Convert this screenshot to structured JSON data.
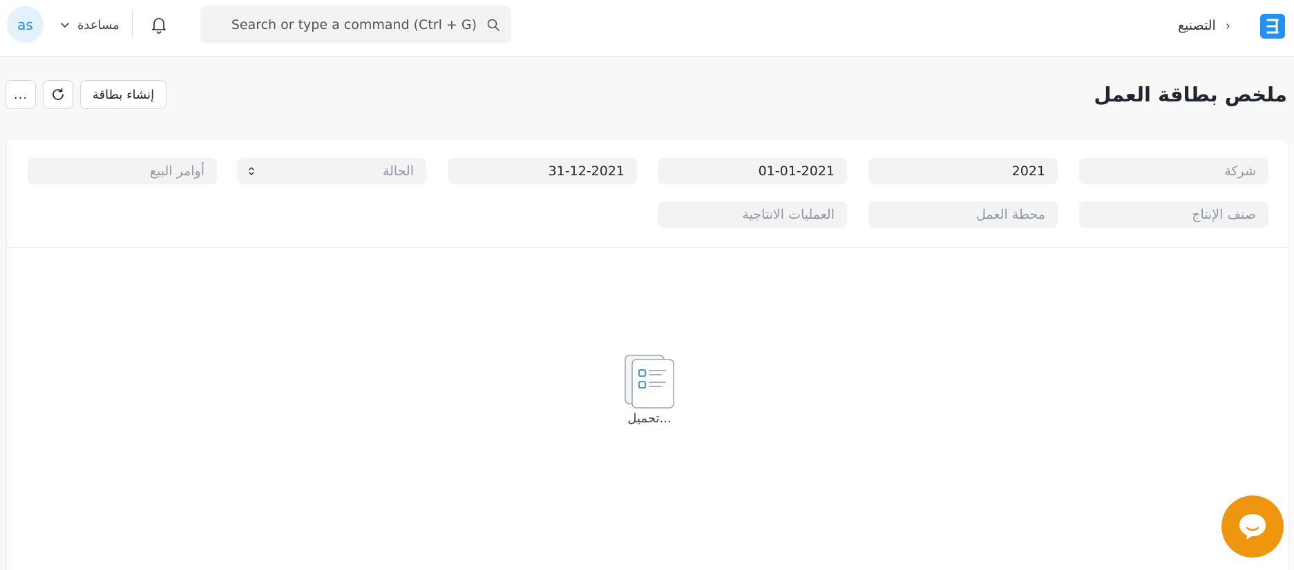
{
  "navbar": {
    "avatar_initials": "as",
    "help_label": "مساعدة",
    "search_placeholder": "Search or type a command (Ctrl + G)",
    "breadcrumb": [
      "التصنيع"
    ],
    "logo_letter": "E",
    "brand_color": "#2490ef"
  },
  "page": {
    "title": "ملخص بطاقة العمل",
    "create_button": "إنشاء بطاقة",
    "menu_button": "...",
    "refresh_icon": "refresh-icon"
  },
  "filters": {
    "company": {
      "placeholder": "شركة",
      "value": ""
    },
    "fiscal_year": {
      "placeholder": "",
      "value": "2021"
    },
    "from_date": {
      "placeholder": "",
      "value": "01-01-2021"
    },
    "to_date": {
      "placeholder": "",
      "value": "31-12-2021"
    },
    "status": {
      "placeholder": "الحالة",
      "value": ""
    },
    "sales_orders": {
      "placeholder": "أوامر البيع",
      "value": ""
    },
    "production_item": {
      "placeholder": "صنف الإنتاج",
      "value": ""
    },
    "workstation": {
      "placeholder": "محطة العمل",
      "value": ""
    },
    "operation": {
      "placeholder": "العمليات الانتاجية",
      "value": ""
    }
  },
  "report": {
    "loading_text": "تحميل..."
  },
  "chat": {
    "icon": "chat-bubble-icon",
    "color": "#f0960e"
  }
}
